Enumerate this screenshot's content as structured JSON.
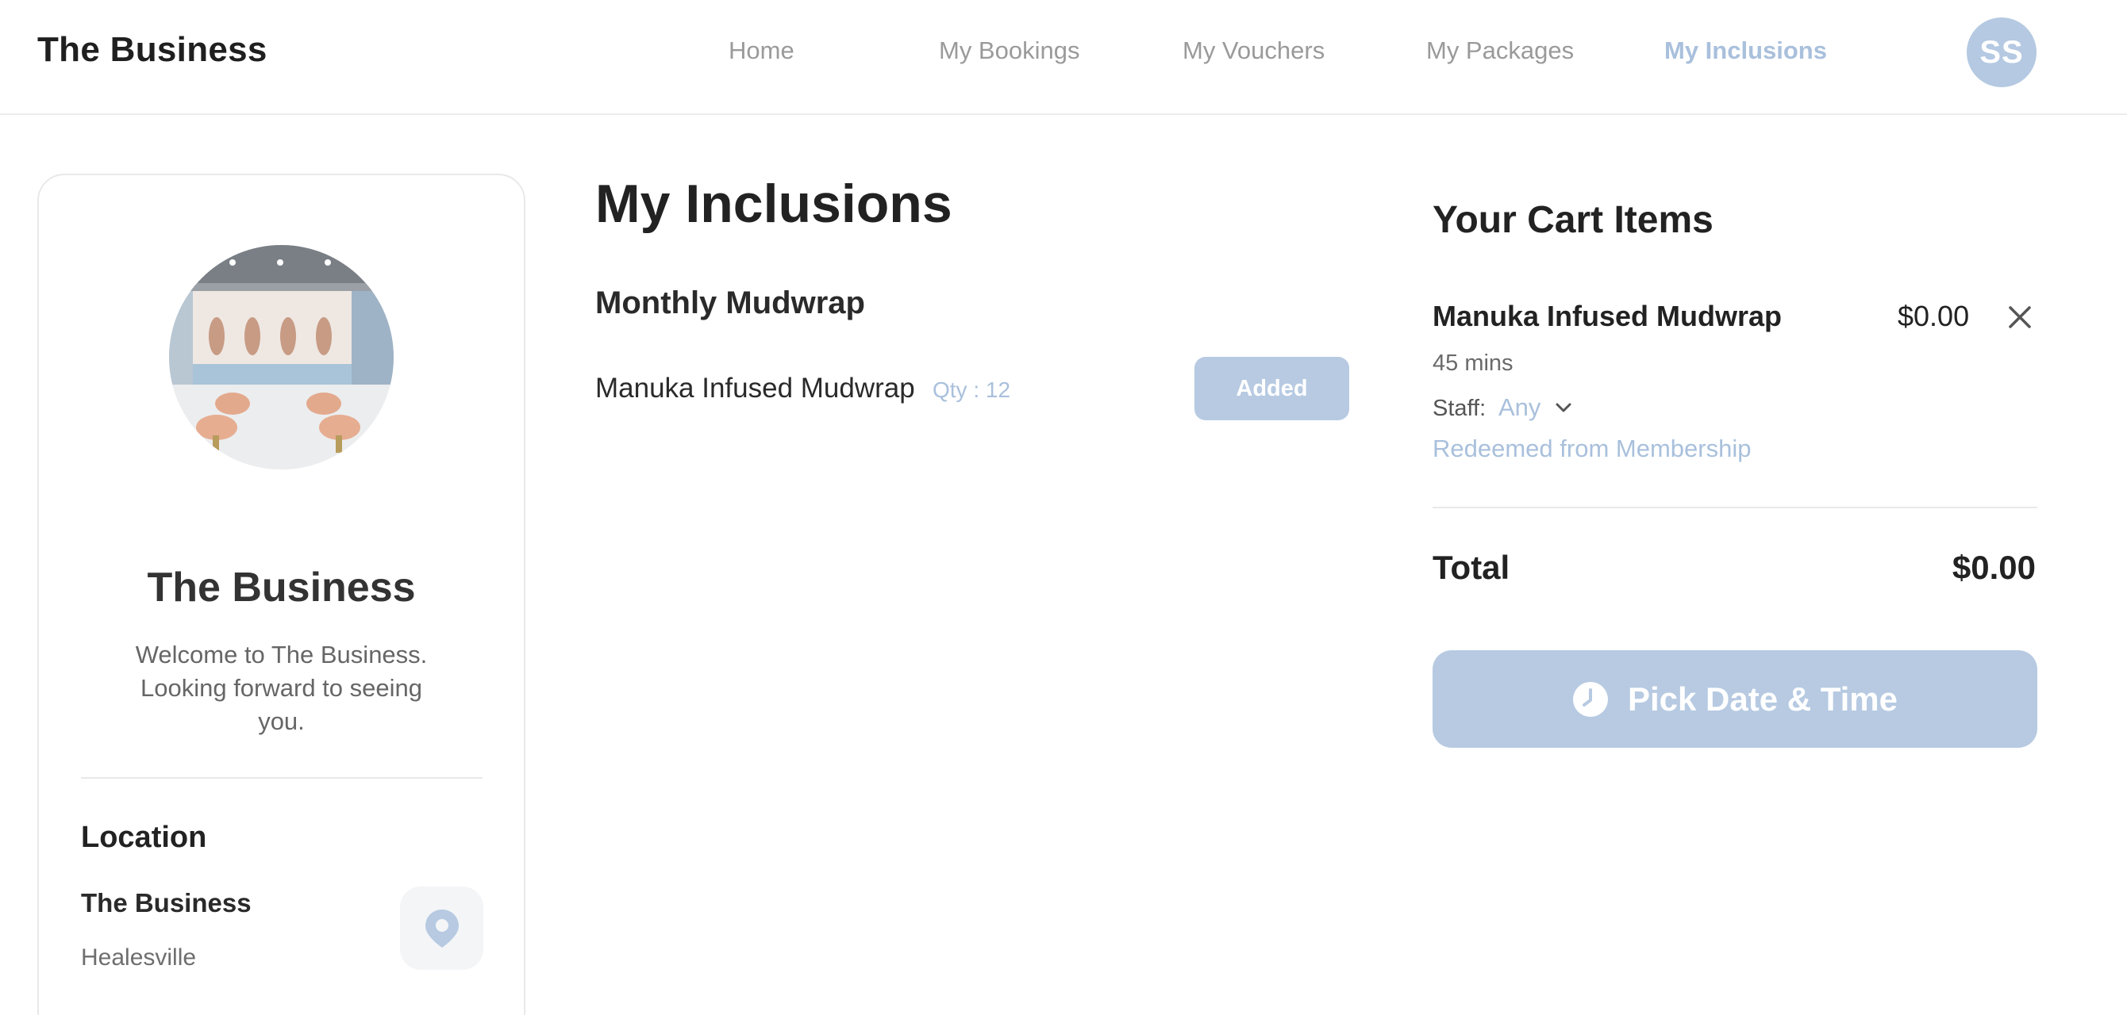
{
  "header": {
    "brand": "The Business",
    "nav": [
      {
        "label": "Home",
        "active": false
      },
      {
        "label": "My Bookings",
        "active": false
      },
      {
        "label": "My Vouchers",
        "active": false
      },
      {
        "label": "My Packages",
        "active": false
      },
      {
        "label": "My Inclusions",
        "active": true
      }
    ],
    "avatar_initials": "SS"
  },
  "business": {
    "name": "The Business",
    "welcome": "Welcome to The Business. Looking forward to seeing you.",
    "location": {
      "title": "Location",
      "name": "The Business",
      "city": "Healesville",
      "icon": "map-pin-icon"
    }
  },
  "inclusions": {
    "title": "My Inclusions",
    "package_name": "Monthly Mudwrap",
    "items": [
      {
        "name": "Manuka Infused Mudwrap",
        "qty": "Qty : 12",
        "button": "Added"
      }
    ]
  },
  "cart": {
    "title": "Your Cart Items",
    "items": [
      {
        "name": "Manuka Infused Mudwrap",
        "price": "$0.00",
        "duration": "45 mins",
        "staff_label": "Staff:",
        "staff_value": "Any",
        "note": "Redeemed from Membership"
      }
    ],
    "total_label": "Total",
    "total_value": "$0.00",
    "cta_label": "Pick Date & Time"
  },
  "colors": {
    "accent": "#a9c0dc",
    "button_fill": "#b7cae2",
    "text": "#222222"
  }
}
